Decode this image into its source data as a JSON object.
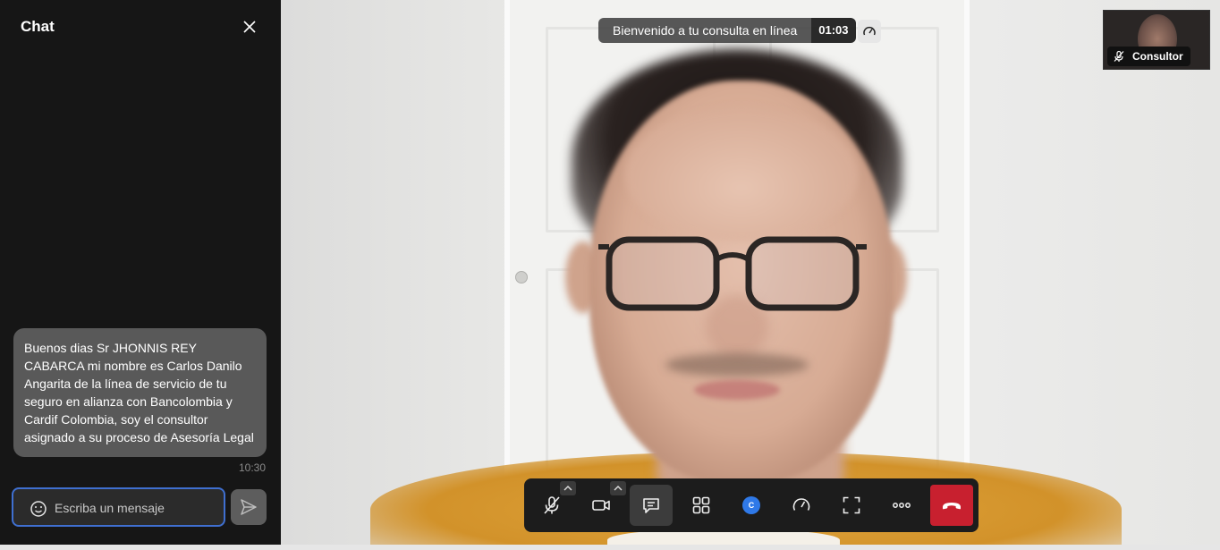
{
  "chat": {
    "title": "Chat",
    "message": {
      "text": "Buenos dias  Sr  JHONNIS REY CABARCA mi nombre es Carlos Danilo Angarita de la línea de servicio de tu seguro en alianza con Bancolombia y Cardif Colombia, soy el consultor asignado a su proceso de Asesoría Legal",
      "time": "10:30"
    },
    "input": {
      "placeholder": "Escriba un mensaje",
      "value": ""
    }
  },
  "call": {
    "banner_text": "Bienvenido a tu consulta en línea",
    "timer": "01:03",
    "self_view_label": "Consultor",
    "controls": [
      {
        "name": "microphone-muted",
        "icon": "mic-off-icon"
      },
      {
        "name": "camera",
        "icon": "video-camera-icon"
      },
      {
        "name": "chat",
        "icon": "chat-bubble-icon",
        "active": true
      },
      {
        "name": "layout",
        "icon": "grid-icon"
      },
      {
        "name": "participant",
        "icon": "avatar-icon",
        "label": "C"
      },
      {
        "name": "connection-quality",
        "icon": "speedometer-icon"
      },
      {
        "name": "fullscreen",
        "icon": "fullscreen-icon"
      },
      {
        "name": "more",
        "icon": "more-dots-icon"
      },
      {
        "name": "hang-up",
        "icon": "phone-hangup-icon"
      }
    ]
  },
  "colors": {
    "sidebar_bg": "#161616",
    "bubble_bg": "#595959",
    "input_border": "#3f6fd0",
    "hangup": "#c8202f",
    "avatar_blue": "#2f79e8"
  }
}
